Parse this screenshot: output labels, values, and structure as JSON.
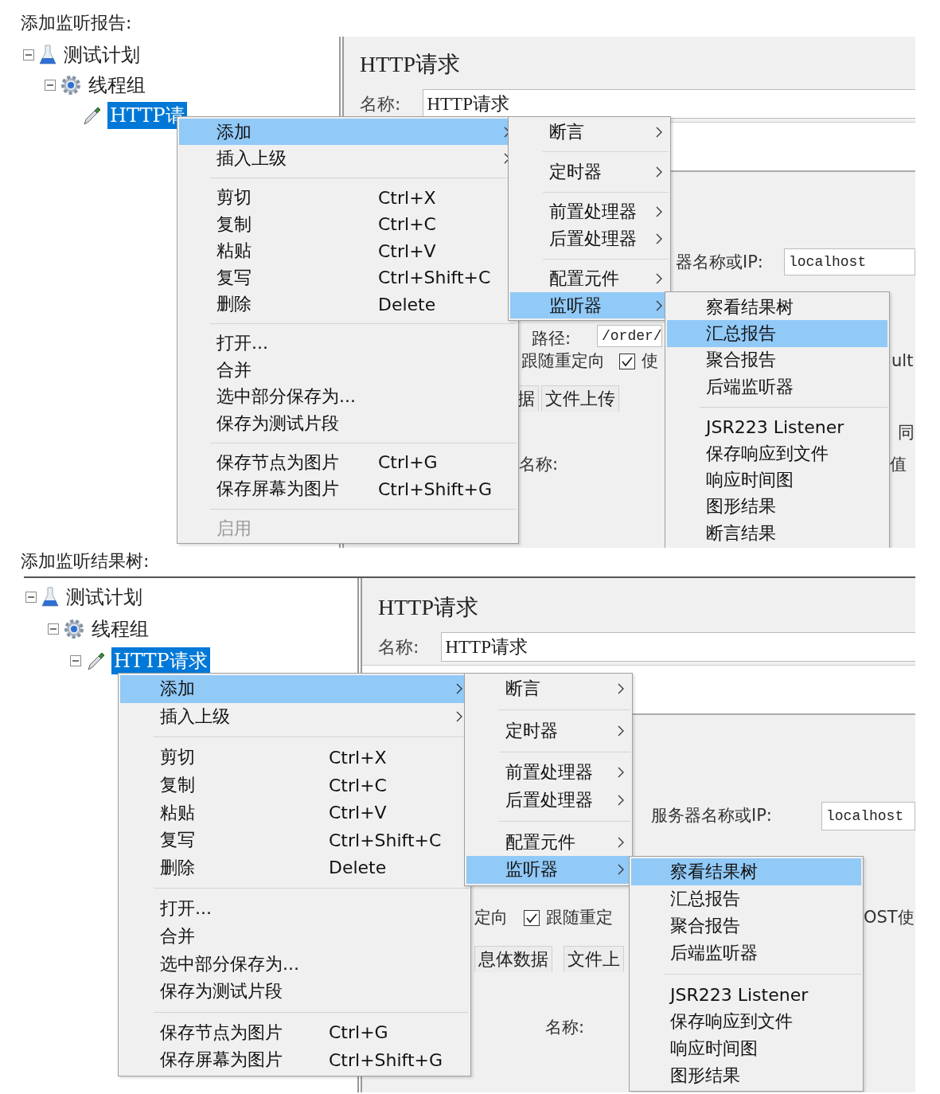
{
  "sections": [
    {
      "caption": "添加监听报告:",
      "tree": [
        {
          "label": "测试计划",
          "expanded": true,
          "selected": false,
          "children": [
            {
              "label": "线程组",
              "expanded": true,
              "selected": false,
              "children": [
                {
                  "label": "HTTP请",
                  "selected": true
                }
              ]
            }
          ]
        }
      ],
      "panel": {
        "title": "HTTP请求",
        "name_label": "名称:",
        "name_value": "HTTP请求",
        "fragments": [
          {
            "kind": "label",
            "text": "器名称或IP:"
          },
          {
            "kind": "field",
            "text": "localhost"
          },
          {
            "kind": "label",
            "text": "路径:"
          },
          {
            "kind": "field",
            "text": "/order/"
          },
          {
            "kind": "label",
            "text": "跟随重定向"
          },
          {
            "kind": "checkbox",
            "text": "使",
            "checked": true
          },
          {
            "kind": "tab",
            "text": "据"
          },
          {
            "kind": "tab",
            "text": "文件上传"
          },
          {
            "kind": "label",
            "text": "名称:"
          },
          {
            "kind": "label",
            "text": "ult"
          },
          {
            "kind": "label",
            "text": "同"
          },
          {
            "kind": "label",
            "text": "值"
          }
        ]
      },
      "menus": [
        [
          {
            "kind": "item",
            "label": "添加",
            "submenu": true,
            "selected": true,
            "disabled": false
          },
          {
            "kind": "item",
            "label": "插入上级",
            "submenu": true,
            "selected": false,
            "disabled": false
          },
          {
            "kind": "separator"
          },
          {
            "kind": "item",
            "label": "剪切",
            "shortcut": "Ctrl+X",
            "submenu": false,
            "selected": false,
            "disabled": false
          },
          {
            "kind": "item",
            "label": "复制",
            "shortcut": "Ctrl+C",
            "submenu": false,
            "selected": false,
            "disabled": false
          },
          {
            "kind": "item",
            "label": "粘贴",
            "shortcut": "Ctrl+V",
            "submenu": false,
            "selected": false,
            "disabled": false
          },
          {
            "kind": "item",
            "label": "复写",
            "shortcut": "Ctrl+Shift+C",
            "submenu": false,
            "selected": false,
            "disabled": false
          },
          {
            "kind": "item",
            "label": "删除",
            "shortcut": "Delete",
            "submenu": false,
            "selected": false,
            "disabled": false
          },
          {
            "kind": "separator"
          },
          {
            "kind": "item",
            "label": "打开...",
            "submenu": false,
            "selected": false,
            "disabled": false
          },
          {
            "kind": "item",
            "label": "合并",
            "submenu": false,
            "selected": false,
            "disabled": false
          },
          {
            "kind": "item",
            "label": "选中部分保存为...",
            "submenu": false,
            "selected": false,
            "disabled": false
          },
          {
            "kind": "item",
            "label": "保存为测试片段",
            "submenu": false,
            "selected": false,
            "disabled": false
          },
          {
            "kind": "separator"
          },
          {
            "kind": "item",
            "label": "保存节点为图片",
            "shortcut": "Ctrl+G",
            "submenu": false,
            "selected": false,
            "disabled": false
          },
          {
            "kind": "item",
            "label": "保存屏幕为图片",
            "shortcut": "Ctrl+Shift+G",
            "submenu": false,
            "selected": false,
            "disabled": false
          },
          {
            "kind": "separator"
          },
          {
            "kind": "item",
            "label": "启用",
            "submenu": false,
            "selected": false,
            "disabled": true
          }
        ],
        [
          {
            "kind": "item",
            "label": "断言",
            "submenu": true,
            "selected": false,
            "disabled": false
          },
          {
            "kind": "separator"
          },
          {
            "kind": "item",
            "label": "定时器",
            "submenu": true,
            "selected": false,
            "disabled": false
          },
          {
            "kind": "separator"
          },
          {
            "kind": "item",
            "label": "前置处理器",
            "submenu": true,
            "selected": false,
            "disabled": false
          },
          {
            "kind": "item",
            "label": "后置处理器",
            "submenu": true,
            "selected": false,
            "disabled": false
          },
          {
            "kind": "separator"
          },
          {
            "kind": "item",
            "label": "配置元件",
            "submenu": true,
            "selected": false,
            "disabled": false
          },
          {
            "kind": "item",
            "label": "监听器",
            "submenu": true,
            "selected": true,
            "disabled": false
          }
        ],
        [
          {
            "kind": "item",
            "label": "察看结果树",
            "submenu": false,
            "selected": false,
            "disabled": false
          },
          {
            "kind": "item",
            "label": "汇总报告",
            "submenu": false,
            "selected": true,
            "disabled": false
          },
          {
            "kind": "item",
            "label": "聚合报告",
            "submenu": false,
            "selected": false,
            "disabled": false
          },
          {
            "kind": "item",
            "label": "后端监听器",
            "submenu": false,
            "selected": false,
            "disabled": false
          },
          {
            "kind": "separator"
          },
          {
            "kind": "item",
            "label": "JSR223 Listener",
            "submenu": false,
            "selected": false,
            "disabled": false
          },
          {
            "kind": "item",
            "label": "保存响应到文件",
            "submenu": false,
            "selected": false,
            "disabled": false
          },
          {
            "kind": "item",
            "label": "响应时间图",
            "submenu": false,
            "selected": false,
            "disabled": false
          },
          {
            "kind": "item",
            "label": "图形结果",
            "submenu": false,
            "selected": false,
            "disabled": false
          },
          {
            "kind": "item",
            "label": "断言结果",
            "submenu": false,
            "selected": false,
            "disabled": false
          }
        ]
      ]
    },
    {
      "caption": "添加监听结果树:",
      "tree": [
        {
          "label": "测试计划",
          "expanded": true,
          "selected": false,
          "children": [
            {
              "label": "线程组",
              "expanded": true,
              "selected": false,
              "children": [
                {
                  "label": "HTTP请求",
                  "expanded": true,
                  "selected": true
                }
              ]
            }
          ]
        }
      ],
      "panel": {
        "title": "HTTP请求",
        "name_label": "名称:",
        "name_value": "HTTP请求",
        "fragments": [
          {
            "kind": "label",
            "text": "服务器名称或IP:"
          },
          {
            "kind": "field",
            "text": "localhost"
          },
          {
            "kind": "label",
            "text": "定向"
          },
          {
            "kind": "checkbox",
            "text": "跟随重定",
            "checked": true
          },
          {
            "kind": "label",
            "text": "OST使"
          },
          {
            "kind": "tab",
            "text": "息体数据"
          },
          {
            "kind": "tab",
            "text": "文件上"
          },
          {
            "kind": "label",
            "text": "名称:"
          }
        ]
      },
      "menus": [
        [
          {
            "kind": "item",
            "label": "添加",
            "submenu": true,
            "selected": true,
            "disabled": false
          },
          {
            "kind": "item",
            "label": "插入上级",
            "submenu": true,
            "selected": false,
            "disabled": false
          },
          {
            "kind": "separator"
          },
          {
            "kind": "item",
            "label": "剪切",
            "shortcut": "Ctrl+X",
            "submenu": false,
            "selected": false,
            "disabled": false
          },
          {
            "kind": "item",
            "label": "复制",
            "shortcut": "Ctrl+C",
            "submenu": false,
            "selected": false,
            "disabled": false
          },
          {
            "kind": "item",
            "label": "粘贴",
            "shortcut": "Ctrl+V",
            "submenu": false,
            "selected": false,
            "disabled": false
          },
          {
            "kind": "item",
            "label": "复写",
            "shortcut": "Ctrl+Shift+C",
            "submenu": false,
            "selected": false,
            "disabled": false
          },
          {
            "kind": "item",
            "label": "删除",
            "shortcut": "Delete",
            "submenu": false,
            "selected": false,
            "disabled": false
          },
          {
            "kind": "separator"
          },
          {
            "kind": "item",
            "label": "打开...",
            "submenu": false,
            "selected": false,
            "disabled": false
          },
          {
            "kind": "item",
            "label": "合并",
            "submenu": false,
            "selected": false,
            "disabled": false
          },
          {
            "kind": "item",
            "label": "选中部分保存为...",
            "submenu": false,
            "selected": false,
            "disabled": false
          },
          {
            "kind": "item",
            "label": "保存为测试片段",
            "submenu": false,
            "selected": false,
            "disabled": false
          },
          {
            "kind": "separator"
          },
          {
            "kind": "item",
            "label": "保存节点为图片",
            "shortcut": "Ctrl+G",
            "submenu": false,
            "selected": false,
            "disabled": false
          },
          {
            "kind": "item",
            "label": "保存屏幕为图片",
            "shortcut": "Ctrl+Shift+G",
            "submenu": false,
            "selected": false,
            "disabled": false
          }
        ],
        [
          {
            "kind": "item",
            "label": "断言",
            "submenu": true,
            "selected": false,
            "disabled": false
          },
          {
            "kind": "separator"
          },
          {
            "kind": "item",
            "label": "定时器",
            "submenu": true,
            "selected": false,
            "disabled": false
          },
          {
            "kind": "separator"
          },
          {
            "kind": "item",
            "label": "前置处理器",
            "submenu": true,
            "selected": false,
            "disabled": false
          },
          {
            "kind": "item",
            "label": "后置处理器",
            "submenu": true,
            "selected": false,
            "disabled": false
          },
          {
            "kind": "separator"
          },
          {
            "kind": "item",
            "label": "配置元件",
            "submenu": true,
            "selected": false,
            "disabled": false
          },
          {
            "kind": "item",
            "label": "监听器",
            "submenu": true,
            "selected": true,
            "disabled": false
          }
        ],
        [
          {
            "kind": "item",
            "label": "察看结果树",
            "submenu": false,
            "selected": true,
            "disabled": false
          },
          {
            "kind": "item",
            "label": "汇总报告",
            "submenu": false,
            "selected": false,
            "disabled": false
          },
          {
            "kind": "item",
            "label": "聚合报告",
            "submenu": false,
            "selected": false,
            "disabled": false
          },
          {
            "kind": "item",
            "label": "后端监听器",
            "submenu": false,
            "selected": false,
            "disabled": false
          },
          {
            "kind": "separator"
          },
          {
            "kind": "item",
            "label": "JSR223 Listener",
            "submenu": false,
            "selected": false,
            "disabled": false
          },
          {
            "kind": "item",
            "label": "保存响应到文件",
            "submenu": false,
            "selected": false,
            "disabled": false
          },
          {
            "kind": "item",
            "label": "响应时间图",
            "submenu": false,
            "selected": false,
            "disabled": false
          },
          {
            "kind": "item",
            "label": "图形结果",
            "submenu": false,
            "selected": false,
            "disabled": false
          }
        ]
      ]
    }
  ]
}
